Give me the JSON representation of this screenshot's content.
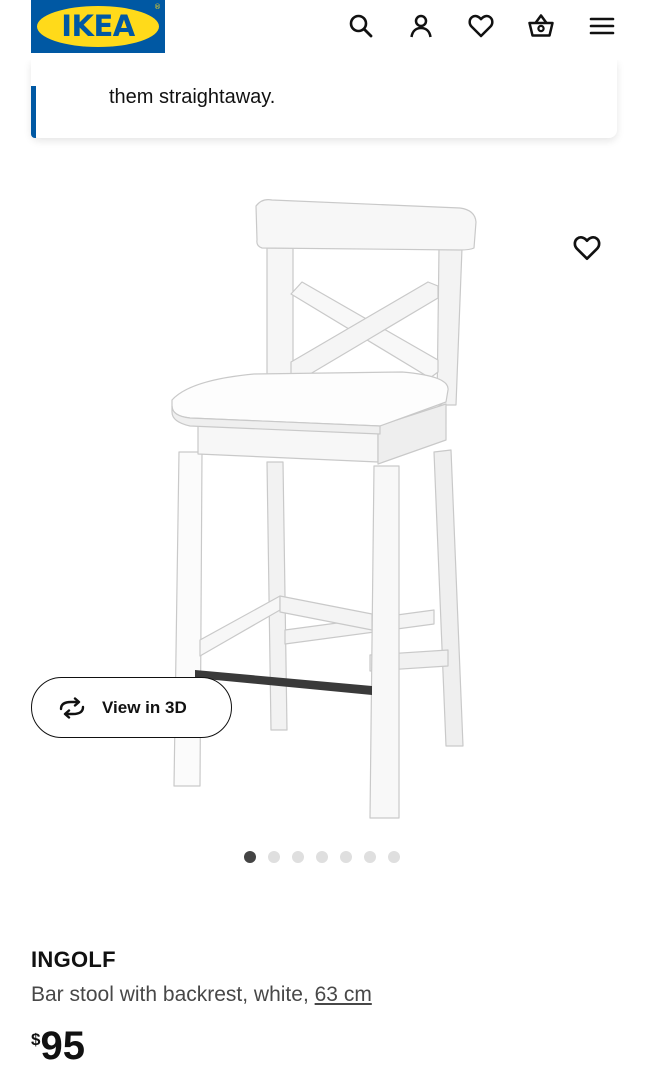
{
  "header": {
    "logo_text": "IKEA",
    "logo_reg": "®",
    "icons": [
      "search-icon",
      "account-icon",
      "favourites-icon",
      "cart-icon",
      "menu-icon"
    ]
  },
  "notice": {
    "text": "them straightaway."
  },
  "product_image": {
    "view3d_label": "View in 3D",
    "slide_count": 7,
    "active_slide": 1
  },
  "product": {
    "name": "INGOLF",
    "description": "Bar stool with backrest, white, ",
    "size_link": "63 cm",
    "currency": "$",
    "price": "95"
  },
  "colors": {
    "brand_blue": "#0058a3",
    "brand_yellow": "#ffda1a",
    "text_primary": "#111111",
    "text_secondary": "#484848"
  }
}
